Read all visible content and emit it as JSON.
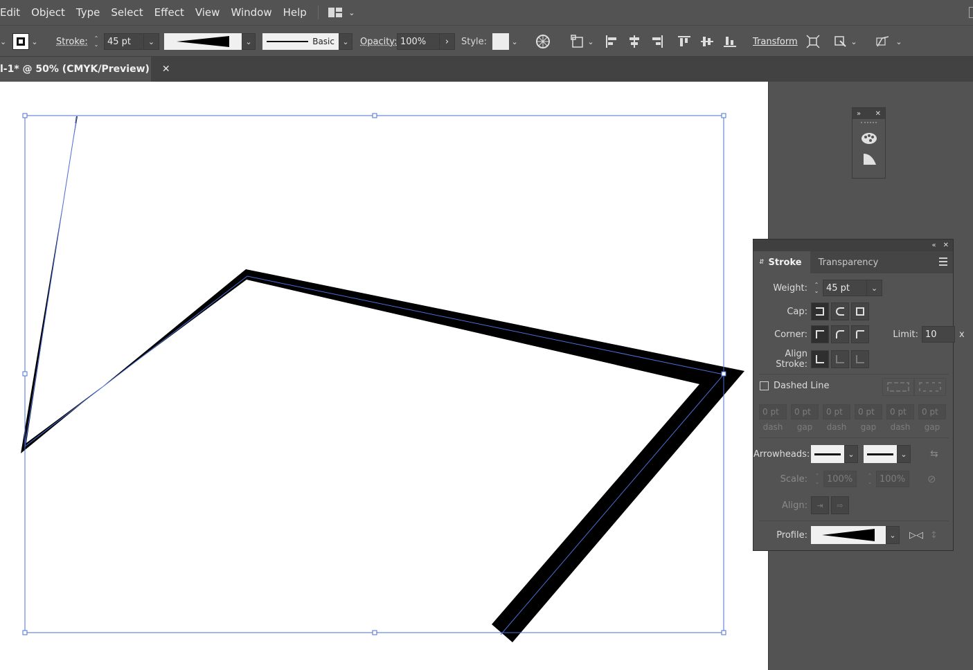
{
  "menu": {
    "items": [
      "Edit",
      "Object",
      "Type",
      "Select",
      "Effect",
      "View",
      "Window",
      "Help"
    ]
  },
  "control_bar": {
    "stroke_label": "Stroke:",
    "stroke_value": "45 pt",
    "profile_label": "Basic",
    "opacity_label": "Opacity:",
    "opacity_value": "100%",
    "style_label": "Style:",
    "transform_label": "Transform"
  },
  "document": {
    "tab_title": "l-1* @ 50% (CMYK/Preview)",
    "close_glyph": "✕"
  },
  "stroke_panel": {
    "tabs": [
      "Stroke",
      "Transparency"
    ],
    "weight_label": "Weight:",
    "weight_value": "45 pt",
    "cap_label": "Cap:",
    "corner_label": "Corner:",
    "limit_label": "Limit:",
    "limit_value": "10",
    "limit_unit": "x",
    "align_label": "Align Stroke:",
    "dashed_label": "Dashed Line",
    "dashed_checked": false,
    "dash_fields": [
      {
        "value": "0 pt",
        "caption": "dash"
      },
      {
        "value": "0 pt",
        "caption": "gap"
      },
      {
        "value": "0 pt",
        "caption": "dash"
      },
      {
        "value": "0 pt",
        "caption": "gap"
      },
      {
        "value": "0 pt",
        "caption": "dash"
      },
      {
        "value": "0 pt",
        "caption": "gap"
      }
    ],
    "arrowheads_label": "Arrowheads:",
    "scale_label": "Scale:",
    "scale_start": "100%",
    "scale_end": "100%",
    "align_arrow_label": "Align:",
    "profile_label": "Profile:"
  },
  "colors": {
    "ui_bg": "#535353",
    "selection": "#4a6fd8",
    "stroke": "#000000"
  }
}
